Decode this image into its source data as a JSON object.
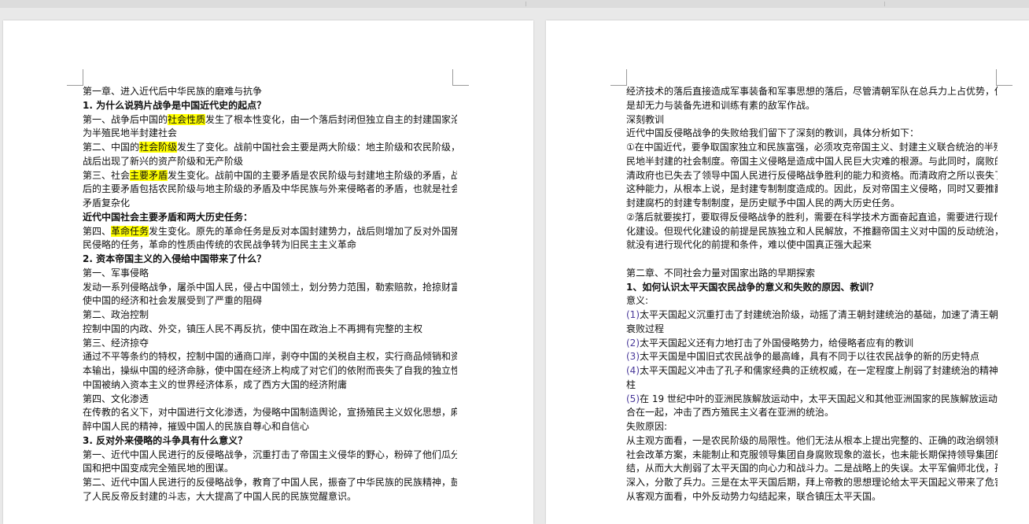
{
  "left_page": {
    "lines": [
      {
        "text": "第一章、进入近代后中华民族的磨难与抗争",
        "bold": false
      },
      {
        "text": "1.   为什么说鸦片战争是中国近代史的起点？",
        "bold": true
      },
      {
        "segments": [
          {
            "text": "第一、战争后中国的"
          },
          {
            "text": "社会性质",
            "hl": true
          },
          {
            "text": "发生了根本性变化，由一个落后封闭但独立自主的封建国家沦"
          }
        ]
      },
      {
        "text": "为半殖民地半封建社会",
        "bold": false
      },
      {
        "segments": [
          {
            "text": "第二、中国的"
          },
          {
            "text": "社会阶级",
            "hl": true
          },
          {
            "text": "发生了变化。战前中国社会主要是两大阶级：地主阶级和农民阶级，"
          }
        ]
      },
      {
        "text": "战后出现了新兴的资产阶级和无产阶级",
        "bold": false
      },
      {
        "segments": [
          {
            "text": "第三、社会"
          },
          {
            "text": "主要矛盾",
            "hl": true
          },
          {
            "text": "发生变化。战前中国的主要矛盾是农民阶级与封建地主阶级的矛盾，战"
          }
        ]
      },
      {
        "text": "后的主要矛盾包括农民阶级与地主阶级的矛盾及中华民族与外来侵略者的矛盾，也就是社会",
        "bold": false
      },
      {
        "text": "矛盾复杂化",
        "bold": false
      },
      {
        "text": "近代中国社会主要矛盾和两大历史任务：",
        "bold": true
      },
      {
        "segments": [
          {
            "text": "第四、"
          },
          {
            "text": "革命任务",
            "hl": true
          },
          {
            "text": "发生变化。原先的革命任务是反对本国封建势力，战后则增加了反对外国殖"
          }
        ]
      },
      {
        "text": "民侵略的任务，革命的性质由传统的农民战争转为旧民主主义革命",
        "bold": false
      },
      {
        "text": "2.   资本帝国主义的入侵给中国带来了什么？",
        "bold": true
      },
      {
        "text": "第一、军事侵略",
        "bold": false
      },
      {
        "text": "发动一系列侵略战争，屠杀中国人民，侵占中国领土，划分势力范围，勒索赔款，抢掠财富，",
        "bold": false
      },
      {
        "text": "使中国的经济和社会发展受到了严重的阻碍",
        "bold": false
      },
      {
        "text": "第二、政治控制",
        "bold": false
      },
      {
        "text": "控制中国的内政、外交，镇压人民不再反抗，使中国在政治上不再拥有完整的主权",
        "bold": false
      },
      {
        "text": "第三、经济掠夺",
        "bold": false
      },
      {
        "text": "通过不平等条约的特权，控制中国的通商口岸，剥夺中国的关税自主权，实行商品倾销和资",
        "bold": false
      },
      {
        "text": "本输出，操纵中国的经济命脉，使中国在经济上构成了对它们的依附而丧失了自我的独立性，",
        "bold": false
      },
      {
        "text": "中国被纳入资本主义的世界经济体系，成了西方大国的经济附庸",
        "bold": false
      },
      {
        "text": "第四、文化渗透",
        "bold": false
      },
      {
        "text": "在传教的名义下，对中国进行文化渗透，为侵略中国制造舆论，宣扬殖民主义奴化思想，麻",
        "bold": false
      },
      {
        "text": "醉中国人民的精神，摧毁中国人的民族自尊心和自信心",
        "bold": false
      },
      {
        "text": "3.   反对外来侵略的斗争具有什么意义？",
        "bold": true
      },
      {
        "text": "第一、近代中国人民进行的反侵略战争，沉重打击了帝国主义侵华的野心，粉碎了他们瓜分中",
        "bold": false
      },
      {
        "text": "国和把中国变成完全殖民地的图谋。",
        "bold": false
      },
      {
        "text": "第二、近代中国人民进行的反侵略战争，教育了中国人民，振奋了中华民族的民族精神，鼓舞",
        "bold": false
      },
      {
        "text": "了人民反帝反封建的斗志，大大提高了中国人民的民族觉醒意识。",
        "bold": false
      }
    ]
  },
  "right_page": {
    "lines": [
      {
        "text": "经济技术的落后直接造成军事装备和军事思想的落后，尽管清朝军队在总兵力上占优势，但",
        "bold": false
      },
      {
        "text": "是却无力与装备先进和训练有素的敌军作战。",
        "bold": false
      },
      {
        "text": "深刻教训",
        "bold": false
      },
      {
        "text": "近代中国反侵略战争的失败给我们留下了深刻的教训，具体分析如下：",
        "bold": false
      },
      {
        "text": "①在中国近代，要争取国家独立和民族富强，必须攻克帝国主义、封建主义联合统治的半殖",
        "bold": false
      },
      {
        "text": "民地半封建的社会制度。帝国主义侵略是造成中国人民巨大灾难的根源。与此同时，腐败的",
        "bold": false
      },
      {
        "text": "清政府也已失去了领导中国人民进行反侵略战争胜利的能力和资格。而清政府之所以丧失了",
        "bold": false
      },
      {
        "text": "这种能力，从根本上说，是封建专制制度造成的。因此，反对帝国主义侵略，同时又要推翻",
        "bold": false
      },
      {
        "text": "封建腐朽的封建专制制度，是历史赋予中国人民的两大历史任务。",
        "bold": false
      },
      {
        "text": "②落后就要挨打，要取得反侵略战争的胜利，需要在科学技术方面奋起直追，需要进行现代",
        "bold": false
      },
      {
        "text": "化建设。但现代化建设的前提是民族独立和人民解放，不推翻帝国主义对中国的反动统治，",
        "bold": false
      },
      {
        "text": "就没有进行现代化的前提和条件，难以使中国真正强大起来",
        "bold": false
      },
      {
        "text": "",
        "bold": false
      },
      {
        "text": "第二章、不同社会力量对国家出路的早期探索",
        "bold": false
      },
      {
        "text": "1、如何认识太平天国农民战争的意义和失败的原因、教训？",
        "bold": true
      },
      {
        "text": "意义:",
        "bold": false
      },
      {
        "segments": [
          {
            "text": "(1)",
            "num": true
          },
          {
            "text": "太平天国起义沉重打击了封建统治阶级，动摇了清王朝封建统治的基础，加速了清王朝的"
          }
        ]
      },
      {
        "text": "衰败过程",
        "bold": false
      },
      {
        "segments": [
          {
            "text": "(2)",
            "num": true
          },
          {
            "text": "太平天国起义还有力地打击了外国侵略势力，给侵略者应有的教训"
          }
        ]
      },
      {
        "segments": [
          {
            "text": "(3)",
            "num": true
          },
          {
            "text": "太平天国是中国旧式农民战争的最高峰，具有不同于以往农民战争的新的历史特点"
          }
        ]
      },
      {
        "segments": [
          {
            "text": "(4)",
            "num": true
          },
          {
            "text": "太平天国起义冲击了孔子和儒家经典的正统权威，在一定程度上削弱了封建统治的精神支"
          }
        ]
      },
      {
        "text": "柱",
        "bold": false
      },
      {
        "segments": [
          {
            "text": "(5)",
            "num": true
          },
          {
            "text": "在 19 世纪中叶的亚洲民族解放运动中，太平天国起义和其他亚洲国家的民族解放运动汇"
          }
        ]
      },
      {
        "text": "合在一起，冲击了西方殖民主义者在亚洲的统治。",
        "bold": false
      },
      {
        "text": "失败原因:",
        "bold": false
      },
      {
        "text": "从主观方面看，一是农民阶级的局限性。他们无法从根本上提出完整的、正确的政治纲领和",
        "bold": false
      },
      {
        "text": "社会改革方案，未能制止和克服领导集团自身腐败现象的滋长，也未能长期保持领导集团的团",
        "bold": false
      },
      {
        "text": "结，从而大大削弱了太平天国的向心力和战斗力。二是战略上的失误。太平军偏师北伐，孤军",
        "bold": false
      },
      {
        "text": "深入，分散了兵力。三是在太平天国后期，拜上帝教的思想理论给太平天国起义带来了危害。",
        "bold": false
      },
      {
        "text": "从客观方面看，中外反动势力勾结起来，联合镇压太平天国。",
        "bold": false
      }
    ]
  },
  "colors": {
    "highlight": "#ffff00",
    "background": "#e9e9e9",
    "page": "#ffffff"
  }
}
